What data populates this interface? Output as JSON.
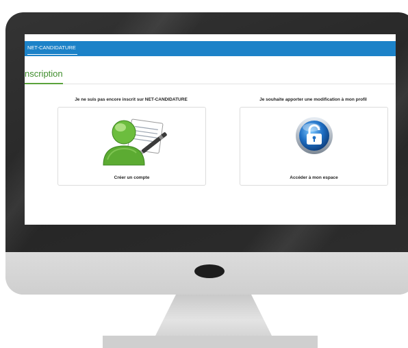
{
  "header": {
    "brand_tab": "NET-CANDIDATURE"
  },
  "page": {
    "title": "nscription"
  },
  "options": [
    {
      "heading_prefix": "Je ne suis pas encore inscrit sur ",
      "heading_strong": "NET-CANDIDATURE",
      "label": "Créer un compte",
      "icon": "user-form-icon"
    },
    {
      "heading": "Je souhaite apporter une modification à mon profil",
      "label": "Accéder à mon espace",
      "icon": "lock-icon"
    }
  ],
  "colors": {
    "header_bar": "#1c82c8",
    "title_green": "#3f8d2c",
    "bezel": "#2b2b2b",
    "chin": "#d8d8d8"
  }
}
